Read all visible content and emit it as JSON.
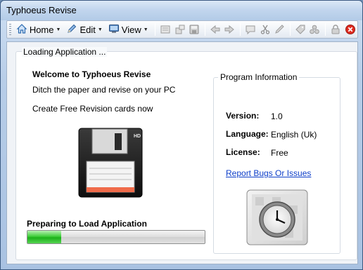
{
  "window": {
    "title": "Typhoeus Revise"
  },
  "toolbar": {
    "home_label": "Home",
    "edit_label": "Edit",
    "view_label": "View"
  },
  "loading": {
    "group_title": "Loading Application ...",
    "welcome": "Welcome to Typhoeus Revise",
    "tagline": "Ditch the paper and revise on your PC",
    "create": "Create Free Revision cards now",
    "progress_label": "Preparing to Load Application",
    "progress_fraction": 0.19,
    "progress_color": "#2ec42a"
  },
  "program_info": {
    "title": "Program Information",
    "version_label": "Version:",
    "version_value": "1.0",
    "language_label": "Language:",
    "language_value": "English (Uk)",
    "license_label": "License:",
    "license_value": "Free",
    "report_link": "Report Bugs Or Issues"
  },
  "icons": {
    "floppy_badge": "HD"
  }
}
